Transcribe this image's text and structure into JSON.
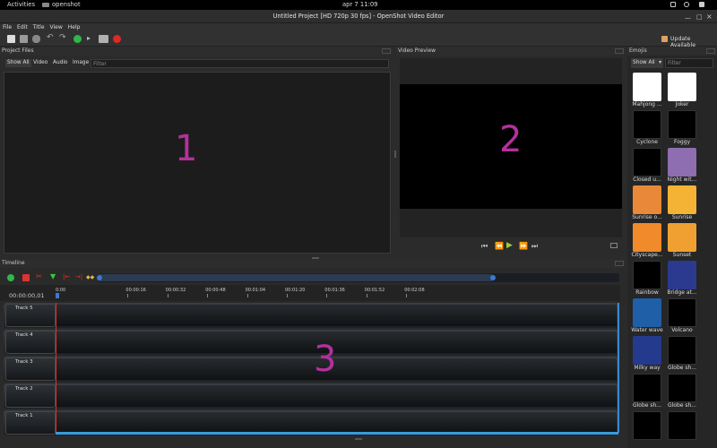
{
  "system_bar": {
    "activities": "Activities",
    "app": "openshot",
    "clock": "apr 7  11:09"
  },
  "window": {
    "title": "Untitled Project [HD 720p 30 fps] - OpenShot Video Editor"
  },
  "menu": [
    "File",
    "Edit",
    "Title",
    "View",
    "Help"
  ],
  "toolbar": {
    "update_label": "Update Available"
  },
  "project_files": {
    "title": "Project Files",
    "tabs": [
      "Show All",
      "Video",
      "Audio",
      "Image"
    ],
    "filter_placeholder": "Filter",
    "marker": "1"
  },
  "video_preview": {
    "title": "Video Preview",
    "marker": "2"
  },
  "emojis": {
    "title": "Emojis",
    "dropdown": "Show All",
    "filter_placeholder": "Filter",
    "items": [
      {
        "label": "Mahjong ...",
        "color": "#ffffff"
      },
      {
        "label": "Joker",
        "color": "#ffffff"
      },
      {
        "label": "Cyclone",
        "color": "#000000"
      },
      {
        "label": "Foggy",
        "color": "#000000"
      },
      {
        "label": "Closed u...",
        "color": "#000000"
      },
      {
        "label": "Night wit...",
        "color": "#8e6db0"
      },
      {
        "label": "Sunrise o...",
        "color": "#e88838"
      },
      {
        "label": "Sunrise",
        "color": "#f5b335"
      },
      {
        "label": "Cityscape...",
        "color": "#f08a2a"
      },
      {
        "label": "Sunset",
        "color": "#f0a030"
      },
      {
        "label": "Rainbow",
        "color": "#000000"
      },
      {
        "label": "Bridge at...",
        "color": "#2b3a8f"
      },
      {
        "label": "Water wave",
        "color": "#1f5fa8"
      },
      {
        "label": "Volcano",
        "color": "#000000"
      },
      {
        "label": "Milky way",
        "color": "#243a8c"
      },
      {
        "label": "Globe sh...",
        "color": "#000000"
      },
      {
        "label": "Globe sh...",
        "color": "#000000"
      },
      {
        "label": "Globe sh...",
        "color": "#000000"
      },
      {
        "label": "",
        "color": "#000000"
      },
      {
        "label": "",
        "color": "#000000"
      }
    ]
  },
  "timeline": {
    "title": "Timeline",
    "timecode": "00:00:00,01",
    "ruler": [
      "0:00",
      "00:00:16",
      "00:00:32",
      "00:00:48",
      "00:01:04",
      "00:01:20",
      "00:01:36",
      "00:01:52",
      "00:02:08"
    ],
    "tracks": [
      "Track 5",
      "Track 4",
      "Track 3",
      "Track 2",
      "Track 1"
    ],
    "marker": "3"
  }
}
